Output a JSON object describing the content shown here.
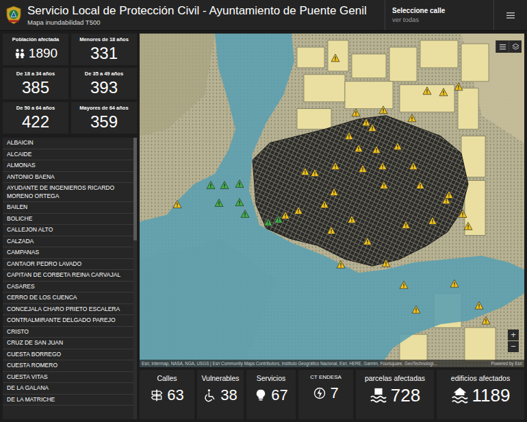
{
  "header": {
    "title": "Servicio Local de Protección Civil - Ayuntamiento de Puente Genil",
    "subtitle": "Mapa inundabilidad T500",
    "selector": {
      "label": "Seleccione calle",
      "value": "ver todas"
    }
  },
  "population_stats": [
    {
      "label": "Población afectada",
      "value": "1890"
    },
    {
      "label": "Menores de 18 años",
      "value": "331"
    },
    {
      "label": "De 18 a 34 años",
      "value": "385"
    },
    {
      "label": "De 35 a 49 años",
      "value": "393"
    },
    {
      "label": "De 50 a 64 años",
      "value": "422"
    },
    {
      "label": "Mayores de 64 años",
      "value": "359"
    }
  ],
  "streets": [
    "ALBAICIN",
    "ALCAIDE",
    "ALMONAS",
    "ANTONIO BAENA",
    "AYUDANTE DE INGENIEROS RICARDO MORENO ORTEGA",
    "BAILEN",
    "BOLICHE",
    "CALLEJON ALTO",
    "CALZADA",
    "CAMPANAS",
    "CANTAOR PEDRO LAVADO",
    "CAPITAN DE CORBETA REINA CARVAJAL",
    "CASARES",
    "CERRO DE LOS CUENCA",
    "CONCEJALA CHARO PRIETO ESCALERA",
    "CONTRALMIRANTE DELGADO PAREJO",
    "CRISTO",
    "CRUZ DE SAN JUAN",
    "CUESTA BORREGO",
    "CUESTA ROMERO",
    "CUESTA VITAS",
    "DE LA GALANA",
    "DE LA MATRICHE"
  ],
  "map": {
    "attribution": "Esri, Intermap, NASA, NGA, USGS | Esri Community Maps Contributors, Instituto Geográfico Nacional, Esri, HERE, Garmin, Foursquare, GeoTechnologi...",
    "powered_by": "Powered by Esri",
    "zoom_in": "+",
    "zoom_out": "−",
    "markers": [
      {
        "color": "#f2c318"
      },
      {
        "color": "#f2c318"
      },
      {
        "color": "#f2c318"
      },
      {
        "color": "#f2c318"
      },
      {
        "color": "#f2c318"
      },
      {
        "color": "#f2c318"
      },
      {
        "color": "#f2c318"
      },
      {
        "color": "#f2c318"
      },
      {
        "color": "#f2c318"
      },
      {
        "color": "#f2c318"
      },
      {
        "color": "#f2c318"
      },
      {
        "color": "#f2c318"
      },
      {
        "color": "#f2c318"
      },
      {
        "color": "#f2c318"
      },
      {
        "color": "#f2c318"
      },
      {
        "color": "#f2c318"
      },
      {
        "color": "#f2c318"
      },
      {
        "color": "#f2c318"
      },
      {
        "color": "#f2c318"
      },
      {
        "color": "#f2c318"
      },
      {
        "color": "#f2c318"
      },
      {
        "color": "#f2c318"
      },
      {
        "color": "#f2c318"
      },
      {
        "color": "#f2c318"
      },
      {
        "color": "#f2c318"
      },
      {
        "color": "#f2c318"
      },
      {
        "color": "#f2c318"
      },
      {
        "color": "#f2c318"
      },
      {
        "color": "#f2c318"
      },
      {
        "color": "#f2c318"
      },
      {
        "color": "#f2c318"
      },
      {
        "color": "#f2c318"
      },
      {
        "color": "#f2c318"
      },
      {
        "color": "#f2c318"
      },
      {
        "color": "#f2c318"
      },
      {
        "color": "#f2c318"
      },
      {
        "color": "#f2c318"
      },
      {
        "color": "#f2c318"
      },
      {
        "color": "#f2c318"
      },
      {
        "color": "#f2c318"
      },
      {
        "color": "#f2c318"
      },
      {
        "color": "#f2c318"
      },
      {
        "color": "#3fb24a"
      },
      {
        "color": "#3fb24a"
      },
      {
        "color": "#3fb24a"
      },
      {
        "color": "#3fb24a"
      },
      {
        "color": "#3fb24a"
      },
      {
        "color": "#3fb24a"
      },
      {
        "color": "#3fb24a"
      },
      {
        "color": "#3fb24a"
      }
    ]
  },
  "summary": [
    {
      "label": "Calles",
      "value": "63"
    },
    {
      "label": "Vulnerables",
      "value": "38"
    },
    {
      "label": "Servicios",
      "value": "67"
    },
    {
      "label": "CT ENDESA",
      "value": "7"
    },
    {
      "label": "parcelas afectadas",
      "value": "728"
    },
    {
      "label": "edificios afectados",
      "value": "1189"
    }
  ]
}
